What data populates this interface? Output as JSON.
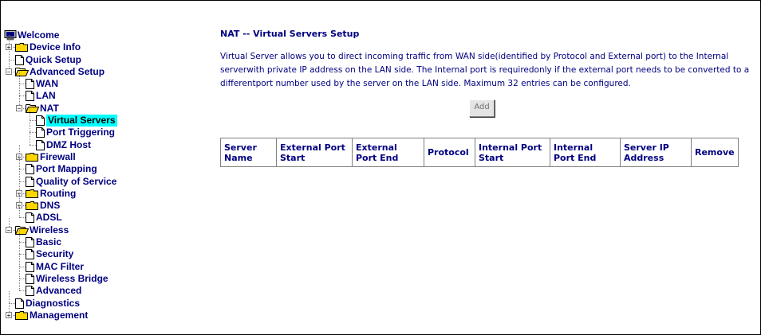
{
  "sidebar": {
    "root": "Welcome",
    "items": [
      {
        "label": "Device Info",
        "level": 1,
        "type": "folder",
        "expander": "plus"
      },
      {
        "label": "Quick Setup",
        "level": 1,
        "type": "page"
      },
      {
        "label": "Advanced Setup",
        "level": 1,
        "type": "folder-open",
        "expander": "minus"
      },
      {
        "label": "WAN",
        "level": 2,
        "type": "page"
      },
      {
        "label": "LAN",
        "level": 2,
        "type": "page"
      },
      {
        "label": "NAT",
        "level": 2,
        "type": "folder-open",
        "expander": "minus"
      },
      {
        "label": "Virtual Servers",
        "level": 3,
        "type": "page",
        "selected": true
      },
      {
        "label": "Port Triggering",
        "level": 3,
        "type": "page"
      },
      {
        "label": "DMZ Host",
        "level": 3,
        "type": "page"
      },
      {
        "label": "Firewall",
        "level": 2,
        "type": "folder",
        "expander": "plus"
      },
      {
        "label": "Port Mapping",
        "level": 2,
        "type": "page"
      },
      {
        "label": "Quality of Service",
        "level": 2,
        "type": "page"
      },
      {
        "label": "Routing",
        "level": 2,
        "type": "folder",
        "expander": "plus"
      },
      {
        "label": "DNS",
        "level": 2,
        "type": "folder",
        "expander": "plus"
      },
      {
        "label": "ADSL",
        "level": 2,
        "type": "page"
      },
      {
        "label": "Wireless",
        "level": 1,
        "type": "folder-open",
        "expander": "minus"
      },
      {
        "label": "Basic",
        "level": 2,
        "type": "page"
      },
      {
        "label": "Security",
        "level": 2,
        "type": "page"
      },
      {
        "label": "MAC Filter",
        "level": 2,
        "type": "page"
      },
      {
        "label": "Wireless Bridge",
        "level": 2,
        "type": "page"
      },
      {
        "label": "Advanced",
        "level": 2,
        "type": "page"
      },
      {
        "label": "Diagnostics",
        "level": 1,
        "type": "page"
      },
      {
        "label": "Management",
        "level": 1,
        "type": "folder",
        "expander": "plus"
      }
    ]
  },
  "main": {
    "title": "NAT -- Virtual Servers Setup",
    "description": "Virtual Server allows you to direct incoming traffic from WAN side(identified by Protocol and External port) to the Internal serverwith private IP address on the LAN side. The Internal port is requiredonly if the external port needs to be converted to a differentport number used by the server on the LAN side. Maximum 32 entries can be configured.",
    "add_label": "Add",
    "table": {
      "headers": [
        "Server Name",
        "External Port Start",
        "External Port End",
        "Protocol",
        "Internal Port Start",
        "Internal Port End",
        "Server IP Address",
        "Remove"
      ],
      "rows": []
    }
  },
  "colors": {
    "text": "#000080",
    "selected_highlight": "#00ffff",
    "folder": "#ffd700"
  }
}
